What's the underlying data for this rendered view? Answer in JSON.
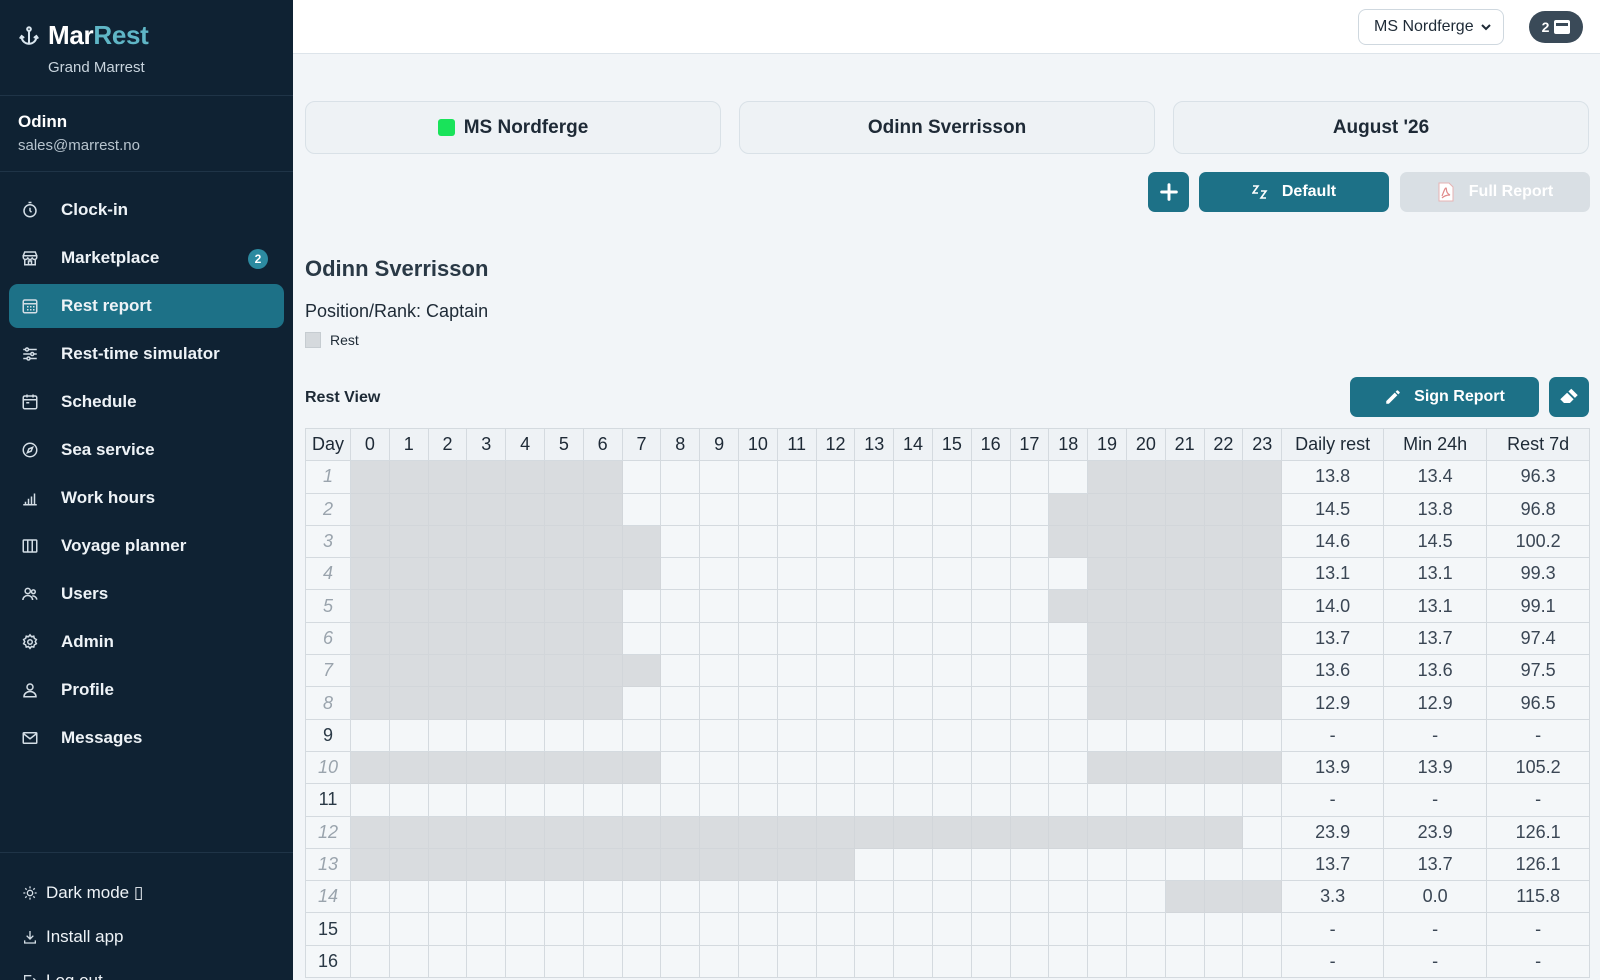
{
  "app": {
    "brand_first": "Mar",
    "brand_second": "Rest",
    "subtitle": "Grand Marrest"
  },
  "user": {
    "name": "Odinn",
    "email": "sales@marrest.no"
  },
  "nav": [
    {
      "label": "Clock-in",
      "icon": "stopwatch-icon"
    },
    {
      "label": "Marketplace",
      "icon": "storefront-icon",
      "badge": "2"
    },
    {
      "label": "Rest report",
      "icon": "calendar-grid-icon",
      "active": true
    },
    {
      "label": "Rest-time simulator",
      "icon": "sliders-icon"
    },
    {
      "label": "Schedule",
      "icon": "calendar-icon"
    },
    {
      "label": "Sea service",
      "icon": "compass-icon"
    },
    {
      "label": "Work hours",
      "icon": "bar-chart-icon"
    },
    {
      "label": "Voyage planner",
      "icon": "map-icon"
    },
    {
      "label": "Users",
      "icon": "users-icon"
    },
    {
      "label": "Admin",
      "icon": "gear-icon"
    },
    {
      "label": "Profile",
      "icon": "person-icon"
    },
    {
      "label": "Messages",
      "icon": "envelope-icon"
    }
  ],
  "bottom": {
    "dark_mode": "Dark mode ▯",
    "install": "Install app",
    "logout": "Log out"
  },
  "topbar": {
    "vessel": "MS Nordferge",
    "badge_count": "2"
  },
  "cards": {
    "vessel": "MS Nordferge",
    "crew": "Odinn Sverrisson",
    "month": "August '26"
  },
  "buttons": {
    "default": "Default",
    "full_report": "Full Report",
    "sign_report": "Sign Report"
  },
  "report": {
    "crew_name": "Odinn Sverrisson",
    "position": "Position/Rank: Captain",
    "legend_rest": "Rest",
    "section_title": "Rest View"
  },
  "colors": {
    "accent": "#1d7187",
    "sidebar": "#0f2233",
    "rest_cell": "#d9dcdf",
    "vessel_dot": "#19e35a"
  },
  "table": {
    "headers": {
      "day": "Day",
      "hours": [
        "0",
        "1",
        "2",
        "3",
        "4",
        "5",
        "6",
        "7",
        "8",
        "9",
        "10",
        "11",
        "12",
        "13",
        "14",
        "15",
        "16",
        "17",
        "18",
        "19",
        "20",
        "21",
        "22",
        "23"
      ],
      "daily": "Daily rest",
      "min24": "Min 24h",
      "rest7": "Rest 7d"
    },
    "rows": [
      {
        "day": "1",
        "faded": true,
        "rest_hours": [
          0,
          1,
          2,
          3,
          4,
          5,
          6,
          19,
          20,
          21,
          22,
          23
        ],
        "daily": "13.8",
        "min24": "13.4",
        "rest7": "96.3"
      },
      {
        "day": "2",
        "faded": true,
        "rest_hours": [
          0,
          1,
          2,
          3,
          4,
          5,
          6,
          18,
          19,
          20,
          21,
          22,
          23
        ],
        "daily": "14.5",
        "min24": "13.8",
        "rest7": "96.8"
      },
      {
        "day": "3",
        "faded": true,
        "rest_hours": [
          0,
          1,
          2,
          3,
          4,
          5,
          6,
          7,
          18,
          19,
          20,
          21,
          22,
          23
        ],
        "daily": "14.6",
        "min24": "14.5",
        "rest7": "100.2"
      },
      {
        "day": "4",
        "faded": true,
        "rest_hours": [
          0,
          1,
          2,
          3,
          4,
          5,
          6,
          7,
          19,
          20,
          21,
          22,
          23
        ],
        "daily": "13.1",
        "min24": "13.1",
        "rest7": "99.3"
      },
      {
        "day": "5",
        "faded": true,
        "rest_hours": [
          0,
          1,
          2,
          3,
          4,
          5,
          6,
          18,
          19,
          20,
          21,
          22,
          23
        ],
        "daily": "14.0",
        "min24": "13.1",
        "rest7": "99.1"
      },
      {
        "day": "6",
        "faded": true,
        "rest_hours": [
          0,
          1,
          2,
          3,
          4,
          5,
          6,
          19,
          20,
          21,
          22,
          23
        ],
        "daily": "13.7",
        "min24": "13.7",
        "rest7": "97.4"
      },
      {
        "day": "7",
        "faded": true,
        "rest_hours": [
          0,
          1,
          2,
          3,
          4,
          5,
          6,
          7,
          19,
          20,
          21,
          22,
          23
        ],
        "daily": "13.6",
        "min24": "13.6",
        "rest7": "97.5"
      },
      {
        "day": "8",
        "faded": true,
        "rest_hours": [
          0,
          1,
          2,
          3,
          4,
          5,
          6,
          19,
          20,
          21,
          22,
          23
        ],
        "daily": "12.9",
        "min24": "12.9",
        "rest7": "96.5"
      },
      {
        "day": "9",
        "faded": false,
        "rest_hours": [],
        "daily": "-",
        "min24": "-",
        "rest7": "-"
      },
      {
        "day": "10",
        "faded": true,
        "rest_hours": [
          0,
          1,
          2,
          3,
          4,
          5,
          6,
          7,
          19,
          20,
          21,
          22,
          23
        ],
        "daily": "13.9",
        "min24": "13.9",
        "rest7": "105.2"
      },
      {
        "day": "11",
        "faded": false,
        "rest_hours": [],
        "daily": "-",
        "min24": "-",
        "rest7": "-"
      },
      {
        "day": "12",
        "faded": true,
        "rest_hours": [
          0,
          1,
          2,
          3,
          4,
          5,
          6,
          7,
          8,
          9,
          10,
          11,
          12,
          13,
          14,
          15,
          16,
          17,
          18,
          19,
          20,
          21,
          22
        ],
        "daily": "23.9",
        "min24": "23.9",
        "rest7": "126.1"
      },
      {
        "day": "13",
        "faded": true,
        "rest_hours": [
          0,
          1,
          2,
          3,
          4,
          5,
          6,
          7,
          8,
          9,
          10,
          11,
          12
        ],
        "daily": "13.7",
        "min24": "13.7",
        "rest7": "126.1"
      },
      {
        "day": "14",
        "faded": true,
        "rest_hours": [
          21,
          22,
          23
        ],
        "daily": "3.3",
        "min24": "0.0",
        "rest7": "115.8"
      },
      {
        "day": "15",
        "faded": false,
        "rest_hours": [],
        "daily": "-",
        "min24": "-",
        "rest7": "-"
      },
      {
        "day": "16",
        "faded": false,
        "rest_hours": [],
        "daily": "-",
        "min24": "-",
        "rest7": "-"
      }
    ]
  }
}
